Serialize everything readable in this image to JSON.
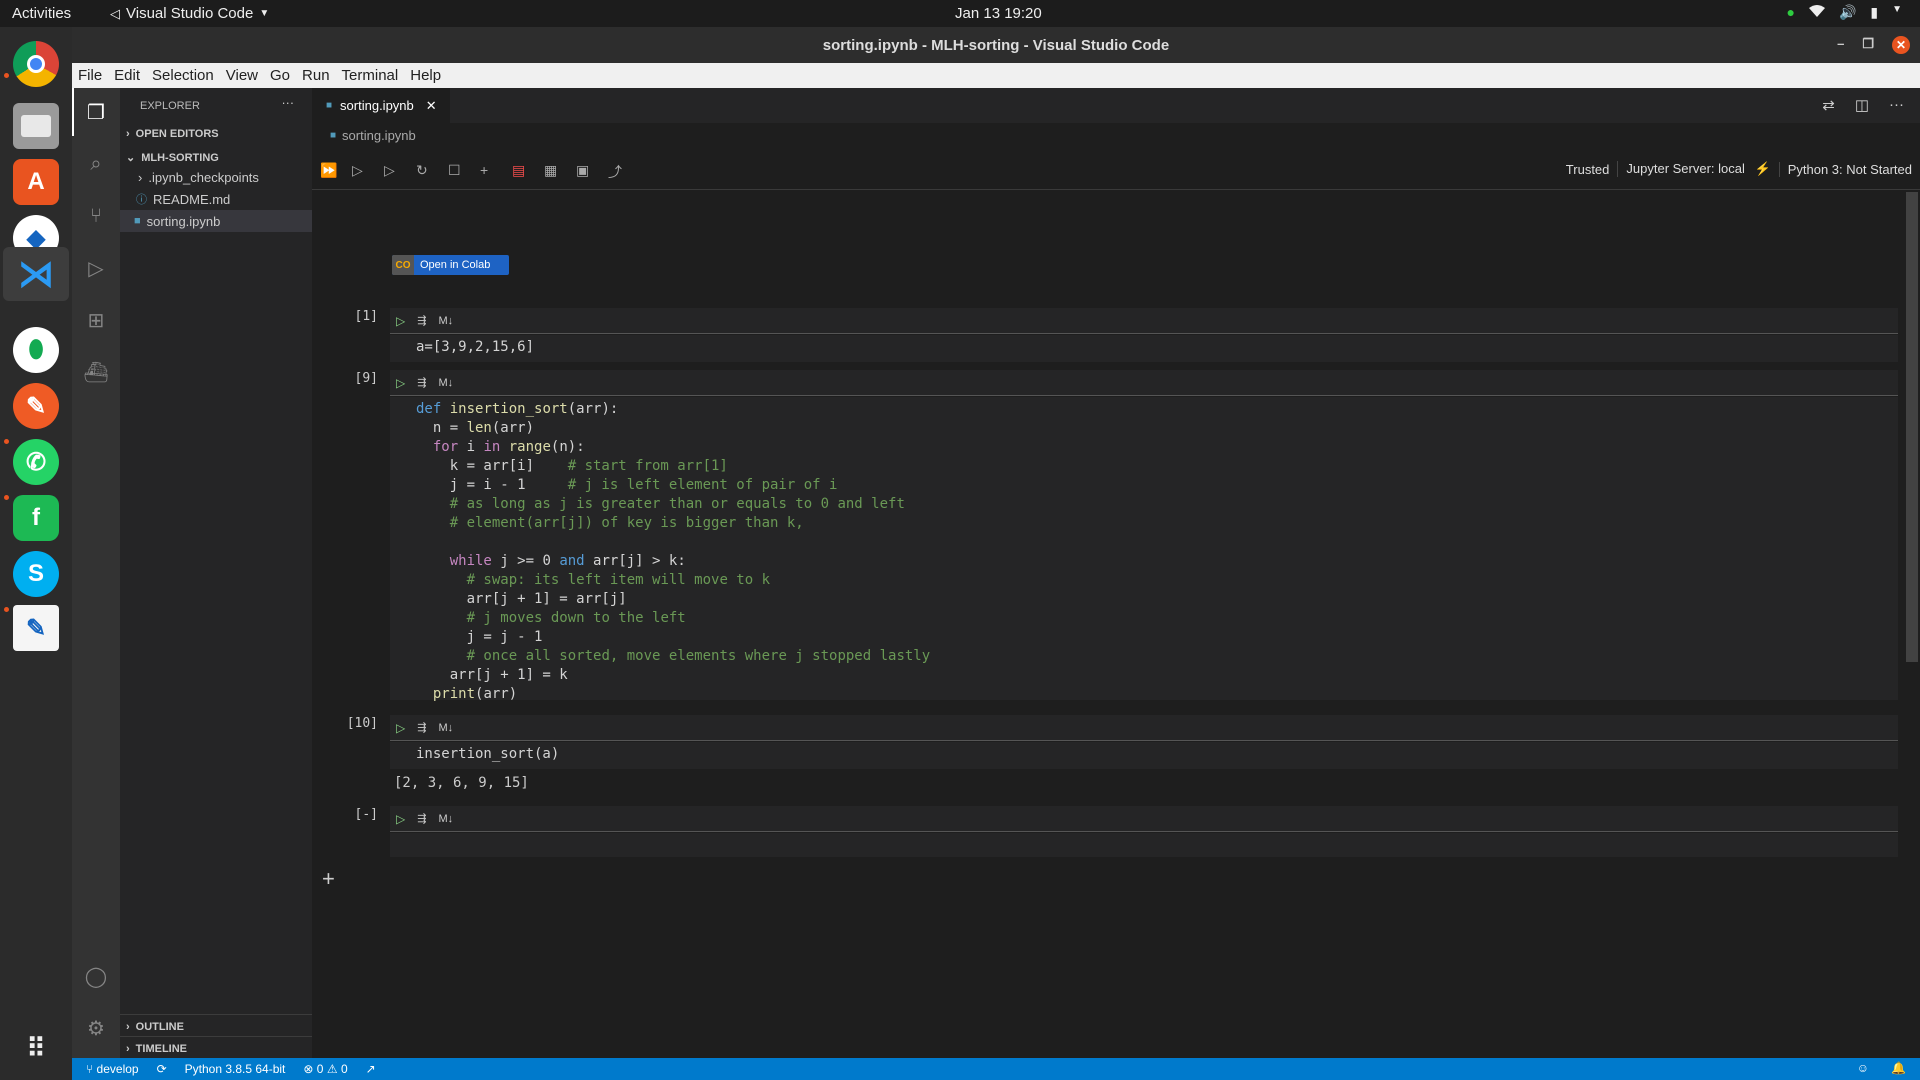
{
  "topbar": {
    "activities": "Activities",
    "app_name": "Visual Studio Code",
    "clock": "Jan 13  19:20"
  },
  "window": {
    "title": "sorting.ipynb - MLH-sorting - Visual Studio Code"
  },
  "menu": [
    "File",
    "Edit",
    "Selection",
    "View",
    "Go",
    "Run",
    "Terminal",
    "Help"
  ],
  "sidebar": {
    "title": "EXPLORER",
    "more": "···",
    "open_editors": "OPEN EDITORS",
    "folder": "MLH-SORTING",
    "items": [
      ".ipynb_checkpoints",
      "README.md",
      "sorting.ipynb"
    ],
    "outline": "OUTLINE",
    "timeline": "TIMELINE"
  },
  "editor": {
    "tab_label": "sorting.ipynb",
    "breadcrumb": "sorting.ipynb",
    "status": {
      "trusted": "Trusted",
      "server": "Jupyter Server: local",
      "kernel": "Python 3: Not Started"
    },
    "colab_label": "Open in Colab",
    "colab_badge": "CO"
  },
  "cells": [
    {
      "count": "[1]",
      "lang": "M↓"
    },
    {
      "count": "[9]",
      "lang": "M↓"
    },
    {
      "count": "[10]",
      "lang": "M↓",
      "output": "[2, 3, 6, 9, 15]"
    },
    {
      "count": "[-]",
      "lang": "M↓"
    }
  ],
  "code": {
    "cell1": "a=[3,9,2,15,6]",
    "cell3": "insertion_sort(a)"
  },
  "statusbar": {
    "branch": "develop",
    "python": "Python 3.8.5 64-bit",
    "errors": "0",
    "warnings": "0"
  },
  "colors": {
    "accent": "#007acc",
    "ubuntu_orange": "#e95420",
    "editor_bg": "#1e1e1e",
    "sidebar_bg": "#252526"
  }
}
